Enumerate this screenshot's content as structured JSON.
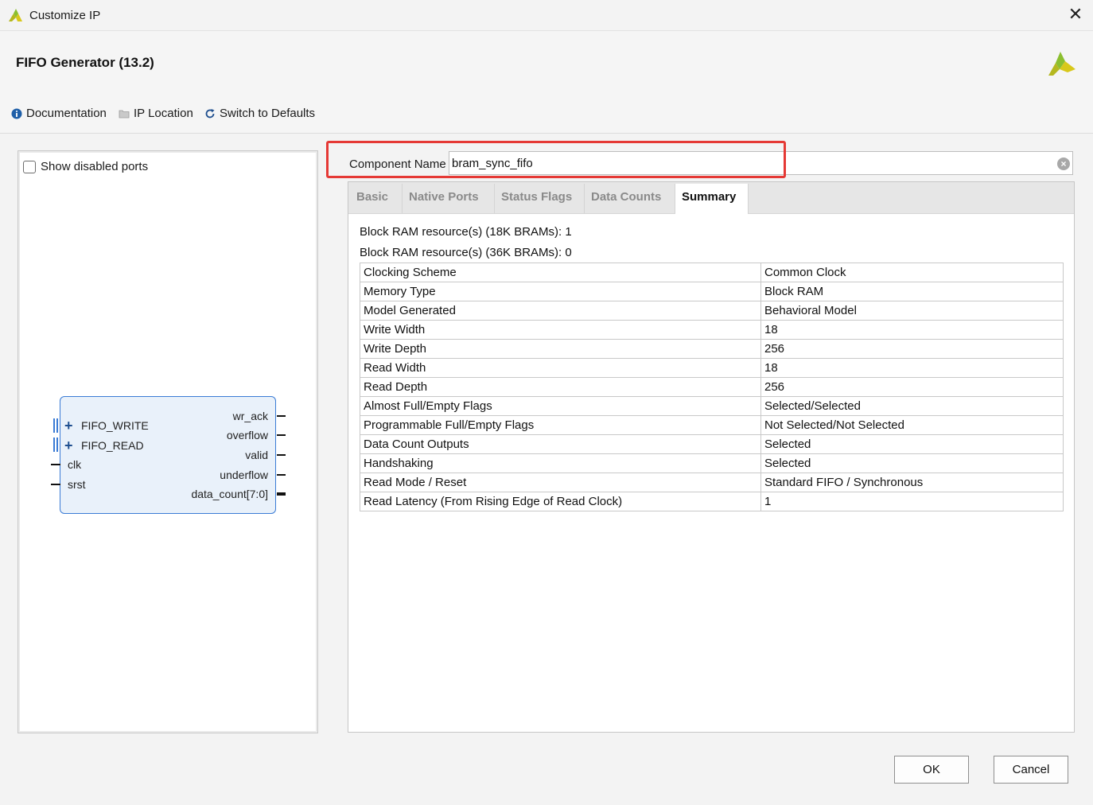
{
  "window": {
    "title": "Customize IP",
    "close_glyph": "✕"
  },
  "header": {
    "title": "FIFO Generator (13.2)",
    "toolbar": [
      {
        "label": "Documentation",
        "icon": "info-icon"
      },
      {
        "label": "IP Location",
        "icon": "folder-icon"
      },
      {
        "label": "Switch to Defaults",
        "icon": "refresh-icon"
      }
    ]
  },
  "left_panel": {
    "show_disabled_ports_label": "Show disabled ports",
    "show_disabled_ports_checked": false,
    "symbol": {
      "left_ports": [
        "FIFO_WRITE",
        "FIFO_READ",
        "clk",
        "srst"
      ],
      "right_ports": [
        "wr_ack",
        "overflow",
        "valid",
        "underflow",
        "data_count[7:0]"
      ]
    }
  },
  "component": {
    "label": "Component Name",
    "value": "bram_sync_fifo"
  },
  "tabs": [
    {
      "label": "Basic",
      "active": false
    },
    {
      "label": "Native Ports",
      "active": false
    },
    {
      "label": "Status Flags",
      "active": false
    },
    {
      "label": "Data Counts",
      "active": false
    },
    {
      "label": "Summary",
      "active": true
    }
  ],
  "summary": {
    "resources": [
      "Block RAM resource(s) (18K BRAMs): 1",
      "Block RAM resource(s) (36K BRAMs): 0"
    ],
    "rows": [
      [
        "Clocking Scheme",
        "Common Clock"
      ],
      [
        "Memory Type",
        "Block RAM"
      ],
      [
        "Model Generated",
        "Behavioral Model"
      ],
      [
        "Write Width",
        "18"
      ],
      [
        "Write Depth",
        "256"
      ],
      [
        "Read Width",
        "18"
      ],
      [
        "Read Depth",
        "256"
      ],
      [
        "Almost Full/Empty Flags",
        "Selected/Selected"
      ],
      [
        "Programmable Full/Empty Flags",
        "Not Selected/Not Selected"
      ],
      [
        "Data Count Outputs",
        "Selected"
      ],
      [
        "Handshaking",
        "Selected"
      ],
      [
        "Read Mode / Reset",
        "Standard FIFO / Synchronous"
      ],
      [
        "Read Latency (From Rising Edge of Read Clock)",
        "1"
      ]
    ]
  },
  "buttons": {
    "ok": "OK",
    "cancel": "Cancel"
  },
  "colors": {
    "highlight": "#e53935",
    "brand_green": "#8dc63f",
    "brand_yellow": "#c8c800"
  }
}
